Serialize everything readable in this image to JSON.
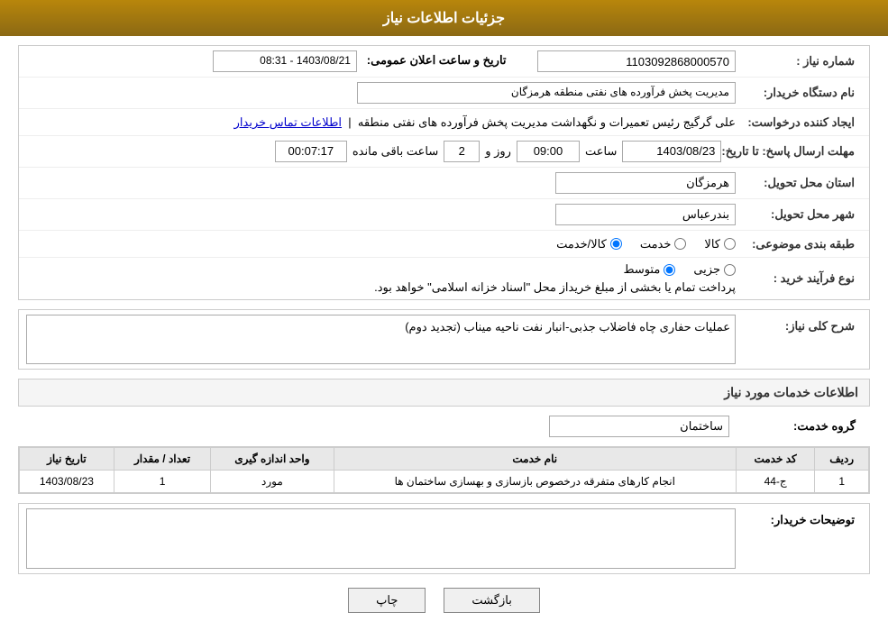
{
  "header": {
    "title": "جزئیات اطلاعات نیاز"
  },
  "fields": {
    "need_number_label": "شماره نیاز :",
    "need_number_value": "1103092868000570",
    "buyer_station_label": "نام دستگاه خریدار:",
    "buyer_station_value": "مدیریت پخش فرآورده های نفتی منطقه هرمزگان",
    "creator_label": "ایجاد کننده درخواست:",
    "creator_value": "علی گرگیج رئیس تعمیرات و نگهداشت مدیریت پخش فرآورده های نفتی منطقه",
    "creator_link": "اطلاعات تماس خریدار",
    "send_date_label": "مهلت ارسال پاسخ: تا تاریخ:",
    "send_date_value": "1403/08/23",
    "send_time_label": "ساعت",
    "send_time_value": "09:00",
    "send_day_label": "روز و",
    "send_day_value": "2",
    "remaining_label": "ساعت باقی مانده",
    "remaining_value": "00:07:17",
    "announce_label": "تاریخ و ساعت اعلان عمومی:",
    "announce_value": "1403/08/21 - 08:31",
    "province_label": "استان محل تحویل:",
    "province_value": "هرمزگان",
    "city_label": "شهر محل تحویل:",
    "city_value": "بندرعباس",
    "category_label": "طبقه بندی موضوعی:",
    "category_options": [
      "کالا",
      "خدمت",
      "کالا/خدمت"
    ],
    "category_selected": "کالا/خدمت",
    "purchase_type_label": "نوع فرآیند خرید :",
    "purchase_type_options": [
      "جزیی",
      "متوسط"
    ],
    "purchase_note": "پرداخت تمام یا بخشی از مبلغ خریداز محل \"اسناد خزانه اسلامی\" خواهد بود.",
    "description_label": "شرح کلی نیاز:",
    "description_value": "عملیات حفاری چاه فاضلاب جذبی-انبار نفت ناحیه میناب (تجدید دوم)"
  },
  "services_section": {
    "title": "اطلاعات خدمات مورد نیاز",
    "group_label": "گروه خدمت:",
    "group_value": "ساختمان",
    "table": {
      "columns": [
        "ردیف",
        "کد خدمت",
        "نام خدمت",
        "واحد اندازه گیری",
        "تعداد / مقدار",
        "تاریخ نیاز"
      ],
      "rows": [
        {
          "row": "1",
          "code": "ج-44",
          "name": "انجام کارهای متفرقه درخصوص بازسازی و بهسازی ساختمان ها",
          "unit": "مورد",
          "quantity": "1",
          "date": "1403/08/23"
        }
      ]
    }
  },
  "buyer_notes": {
    "label": "توضیحات خریدار:",
    "value": ""
  },
  "buttons": {
    "print": "چاپ",
    "back": "بازگشت"
  }
}
